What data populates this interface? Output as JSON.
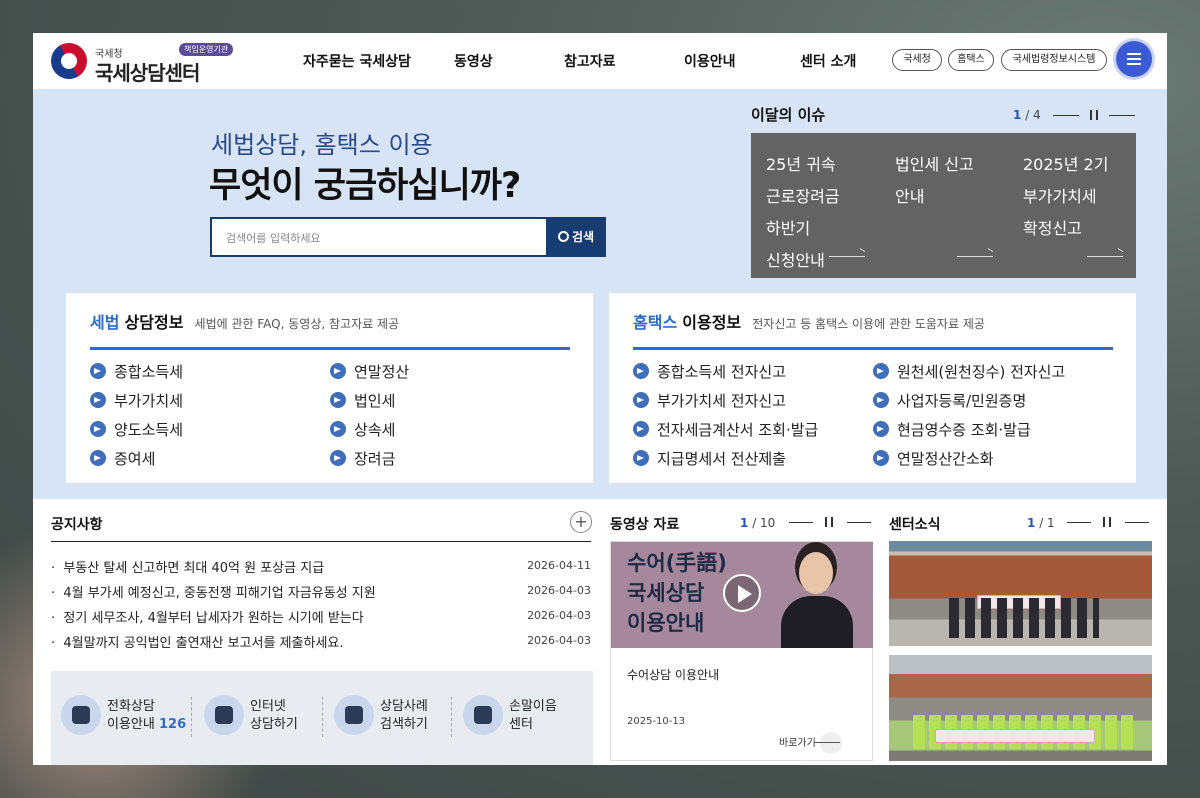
{
  "header": {
    "logo_small": "국세청",
    "logo_badge": "책임운영기관",
    "logo_main": "국세상담센터",
    "nav": [
      "자주묻는 국세상담",
      "동영상",
      "참고자료",
      "이용안내",
      "센터 소개"
    ],
    "ext_links": [
      "국세청",
      "홈택스",
      "국세법령정보시스템"
    ],
    "menu_icon": "hamburger-icon",
    "menu_color": "#3b5bd6"
  },
  "hero": {
    "subtitle": "세법상담, 홈택스 이용",
    "title": "무엇이 궁금하십니까?",
    "search_placeholder": "검색어를 입력하세요",
    "search_button": "검색",
    "issue": {
      "title": "이달의 이슈",
      "page_current": "1",
      "page_total": "/ 4",
      "items": [
        "25년 귀속 근로장려금 하반기 신청안내",
        "법인세 신고 안내",
        "2025년 2기 부가가치세 확정신고"
      ]
    }
  },
  "cards": {
    "tax": {
      "title_accent": "세법",
      "title_main": "상담정보",
      "desc": "세법에 관한 FAQ, 동영상, 참고자료 제공",
      "items": [
        "종합소득세",
        "연말정산",
        "부가가치세",
        "법인세",
        "양도소득세",
        "상속세",
        "증여세",
        "장려금"
      ]
    },
    "hometax": {
      "title_accent": "홈택스",
      "title_main": "이용정보",
      "desc": "전자신고 등 홈택스 이용에 관한 도움자료 제공",
      "items": [
        "종합소득세 전자신고",
        "원천세(원천징수) 전자신고",
        "부가가치세 전자신고",
        "사업자등록/민원증명",
        "전자세금계산서 조회·발급",
        "현금영수증 조회·발급",
        "지급명세서 전산제출",
        "연말정산간소화"
      ]
    }
  },
  "notice": {
    "title": "공지사항",
    "more_label": "+",
    "rows": [
      {
        "text": "부동산 탈세 신고하면 최대 40억 원 포상금 지급",
        "date": "2026-04-11"
      },
      {
        "text": "4월 부가세 예정신고, 중동전쟁 피해기업 자금유동성 지원",
        "date": "2026-04-03"
      },
      {
        "text": "정기 세무조사, 4월부터 납세자가 원하는 시기에 받는다",
        "date": "2026-04-03"
      },
      {
        "text": "4월말까지 공익법인 출연재산 보고서를 제출하세요.",
        "date": "2026-04-03"
      }
    ]
  },
  "quick": [
    {
      "line1": "전화상담",
      "line2": "이용안내",
      "num": "126",
      "icon": "phone-icon"
    },
    {
      "line1": "인터넷",
      "line2": "상담하기",
      "num": "",
      "icon": "monitor-icon"
    },
    {
      "line1": "상담사례",
      "line2": "검색하기",
      "num": "",
      "icon": "magnifier-icon"
    },
    {
      "line1": "손말이음",
      "line2": "센터",
      "num": "",
      "icon": "building-icon"
    }
  ],
  "video": {
    "title": "동영상 자료",
    "page_current": "1",
    "page_total": "/ 10",
    "thumb_lines": [
      "수어(手語)",
      "국세상담",
      "이용안내"
    ],
    "caption": "수어상담 이용안내",
    "date": "2025-10-13",
    "go_label": "바로가기"
  },
  "news": {
    "title": "센터소식",
    "page_current": "1",
    "page_total": "/ 1"
  }
}
